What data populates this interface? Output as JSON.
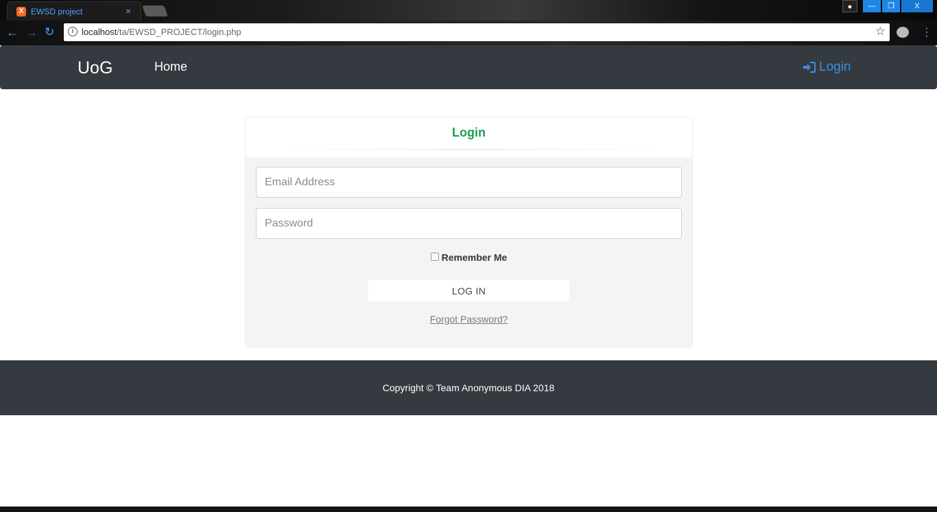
{
  "browser": {
    "tab_title": "EWSD project",
    "tab_close": "×",
    "favicon_letter": "X",
    "url_host": "localhost",
    "url_path": "/ta/EWSD_PROJECT/login.php",
    "window_controls": {
      "minimize": "—",
      "restore": "❐",
      "close": "X"
    }
  },
  "navbar": {
    "brand": "UoG",
    "home": "Home",
    "login": "Login",
    "login_color": "#3e8ee0"
  },
  "login_card": {
    "title": "Login",
    "title_color": "#1f9d55",
    "email_placeholder": "Email Address",
    "password_placeholder": "Password",
    "remember_label": "Remember Me",
    "remember_checked": false,
    "submit_label": "LOG IN",
    "forgot_label": "Forgot Password?"
  },
  "footer": {
    "copyright": "Copyright © Team Anonymous DIA 2018"
  },
  "icons": {
    "back": "arrow-left-icon",
    "forward": "arrow-right-icon",
    "reload": "reload-icon",
    "info": "info-icon",
    "bookmark": "star-icon",
    "login": "sign-in-icon"
  }
}
